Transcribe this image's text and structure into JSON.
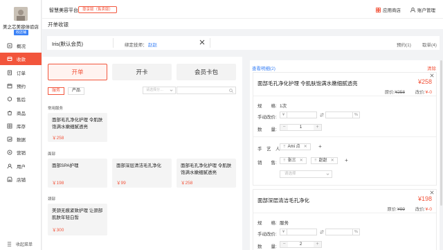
{
  "colors": {
    "brand": "#f2553c",
    "link": "#3b82f6",
    "page_bg": "#f2f3f5"
  },
  "sidebar": {
    "store_name": "美之芯美容体验店",
    "store_tag": "收店铺",
    "items": [
      {
        "label": "概况",
        "icon": "dashboard-icon",
        "active": false
      },
      {
        "label": "收款",
        "icon": "cashier-icon",
        "active": true
      },
      {
        "label": "订单",
        "icon": "order-icon",
        "active": false
      },
      {
        "label": "预约",
        "icon": "calendar-icon",
        "active": false
      },
      {
        "label": "售后",
        "icon": "after-sales-icon",
        "active": false
      },
      {
        "label": "商品",
        "icon": "goods-icon",
        "active": false
      },
      {
        "label": "库存",
        "icon": "inventory-icon",
        "active": false
      },
      {
        "label": "数据",
        "icon": "data-icon",
        "active": false
      },
      {
        "label": "营销",
        "icon": "marketing-icon",
        "active": false
      },
      {
        "label": "用户",
        "icon": "user-icon",
        "active": false
      },
      {
        "label": "店铺",
        "icon": "store-icon",
        "active": false
      }
    ],
    "collapse_label": "收起菜单"
  },
  "header": {
    "platform": "智慧美容平台",
    "edition": "尊享版（售卖版）",
    "app_store": "应用商店",
    "account": "账户管理"
  },
  "page": {
    "title": "开单收银"
  },
  "member": {
    "name": "Iris(默认会员)",
    "tech_label": "绑定技师：",
    "tech_value": "赵赵",
    "appointment": "预约(1)",
    "takeout": "取单(4)"
  },
  "left": {
    "tabs": [
      "开单",
      "开卡",
      "会员卡包"
    ],
    "segments": [
      "服务",
      "产品"
    ],
    "category_placeholder": "请选择分…",
    "sections": [
      "常用服务",
      "面部",
      "颈部"
    ],
    "cards": {
      "common": [
        {
          "name": "面部毛孔净化护理 令肌肤饱满水嫩细腻透亮",
          "price": "￥258"
        }
      ],
      "face": [
        {
          "name": "面部SPA护理",
          "price": "￥198"
        },
        {
          "name": "面部深层清洁毛孔净化",
          "price": "￥99"
        },
        {
          "name": "面部毛孔净化护理 令肌肤饱满水嫩细腻透亮",
          "price": "￥258"
        }
      ],
      "neck": [
        {
          "name": "美颈无痕紧致护理 让颈部肌肤年轻白皙",
          "price": "￥300"
        }
      ]
    }
  },
  "right": {
    "detail_link": "查看明细(2)",
    "clear": "清除",
    "labels": {
      "spec": "规　　格:",
      "manual": "手动改价:",
      "qty": "数　　量:",
      "artisan": "手　艺　人:",
      "sales": "销　　售:",
      "orig_prefix": "原价:",
      "adj_prefix": "改价:",
      "yen": "¥",
      "percent": "%",
      "minus": "−",
      "plus": "+",
      "add": "+",
      "select_placeholder": "请选择"
    },
    "items": [
      {
        "name": "面部毛孔净化护理 令肌肤饱满水嫩细腻透亮",
        "price": "¥258",
        "orig": "¥258",
        "adj": "¥-0",
        "spec": "1次",
        "qty": "1",
        "artisan": "Ami 点",
        "sales": [
          "张三",
          "赵赵"
        ]
      },
      {
        "name": "面部深层清洁毛孔净化",
        "price": "¥198",
        "orig": "¥99",
        "adj": "¥-0",
        "spec": "服务",
        "qty": "2"
      }
    ]
  }
}
